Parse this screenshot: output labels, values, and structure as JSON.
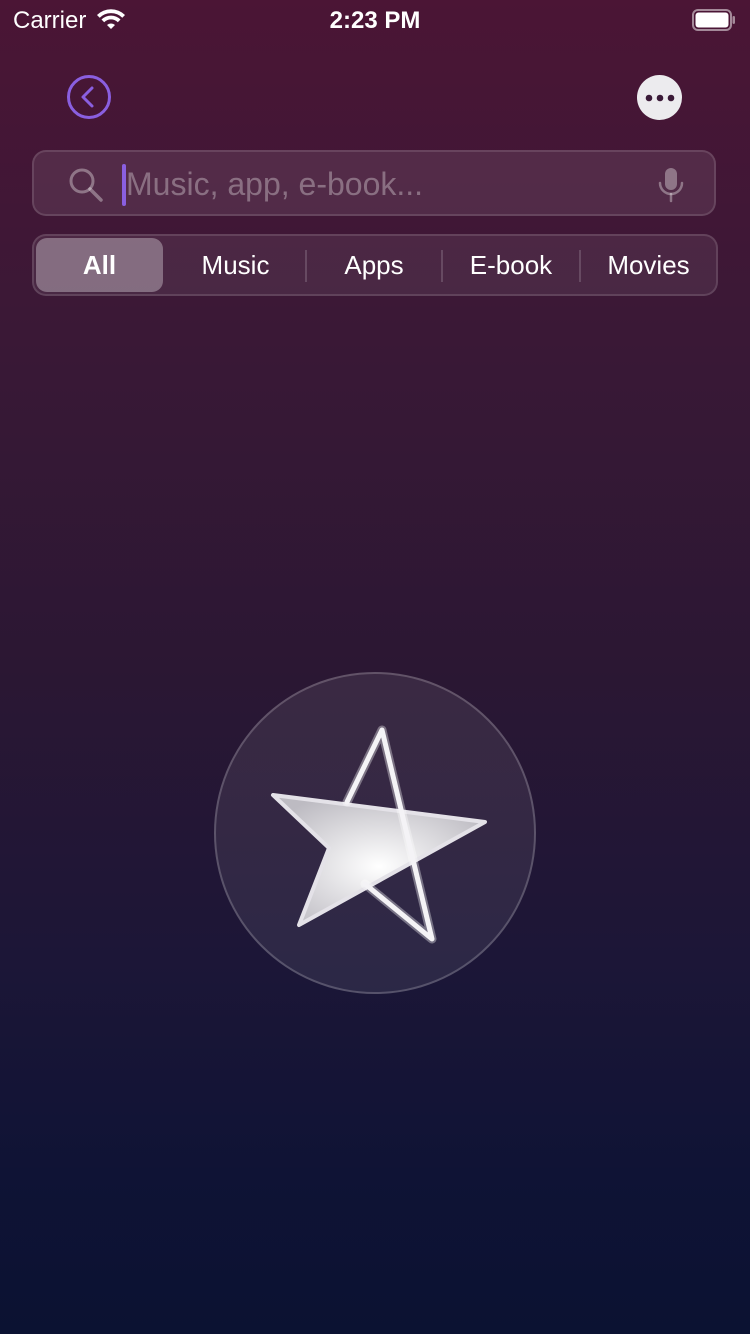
{
  "status_bar": {
    "carrier": "Carrier",
    "time": "2:23 PM"
  },
  "navigation": {
    "back_icon": "chevron-left-circle-icon",
    "more_icon": "ellipsis-circle-icon"
  },
  "search": {
    "value": "",
    "placeholder": "Music, app, e-book...",
    "search_icon": "magnifying-glass-icon",
    "mic_icon": "microphone-icon"
  },
  "segments": {
    "selected": "All",
    "items": [
      {
        "label": "All"
      },
      {
        "label": "Music"
      },
      {
        "label": "Apps"
      },
      {
        "label": "E-book"
      },
      {
        "label": "Movies"
      }
    ]
  },
  "logo": {
    "icon": "star-logo-icon"
  },
  "colors": {
    "accent": "#8a5fe0",
    "gradient_top": "#4b1535",
    "gradient_bottom": "#0b1232"
  }
}
